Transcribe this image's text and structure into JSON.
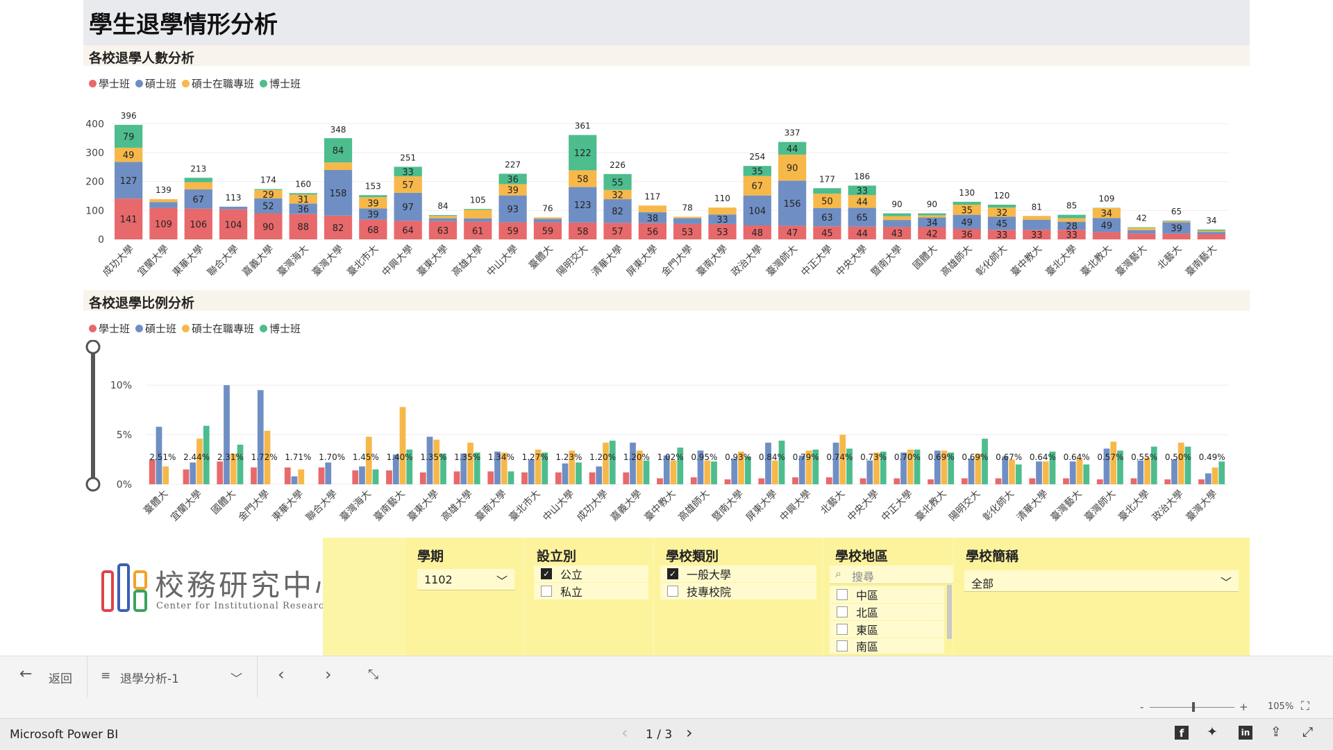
{
  "title": "學生退學情形分析",
  "colors": {
    "bachelor": "#e8696b",
    "master": "#6f8fc4",
    "inservice": "#f7b84a",
    "phd": "#4dbd8e",
    "title_bg": "#e9eaee",
    "section_bg": "#f8f4ec",
    "slicer_bg": "#fdf39d"
  },
  "legend": [
    "學士班",
    "碩士班",
    "碩士在職專班",
    "博士班"
  ],
  "section1": {
    "title": "各校退學人數分析"
  },
  "section2": {
    "title": "各校退學比例分析"
  },
  "chart_data": [
    {
      "type": "bar",
      "stacked": true,
      "title": "各校退學人數分析",
      "y_ticks": [
        "0",
        "100",
        "200",
        "300",
        "400"
      ],
      "ylim": [
        0,
        420
      ],
      "categories": [
        "成功大學",
        "宜蘭大學",
        "東華大學",
        "聯合大學",
        "嘉義大學",
        "臺灣海大",
        "臺灣大學",
        "臺北市大",
        "中興大學",
        "臺東大學",
        "高雄大學",
        "中山大學",
        "臺體大",
        "陽明交大",
        "清華大學",
        "屏東大學",
        "金門大學",
        "臺南大學",
        "政治大學",
        "臺灣師大",
        "中正大學",
        "中央大學",
        "暨南大學",
        "國體大",
        "高雄師大",
        "彰化師大",
        "臺中教大",
        "臺北大學",
        "臺北教大",
        "臺灣藝大",
        "北藝大",
        "臺南藝大"
      ],
      "totals": [
        396,
        139,
        213,
        113,
        174,
        160,
        348,
        153,
        251,
        84,
        105,
        227,
        76,
        361,
        226,
        117,
        78,
        110,
        254,
        337,
        177,
        186,
        90,
        90,
        130,
        120,
        81,
        85,
        109,
        42,
        65,
        34
      ],
      "series": [
        {
          "name": "學士班",
          "values": [
            141,
            109,
            106,
            104,
            90,
            88,
            82,
            68,
            64,
            63,
            61,
            59,
            59,
            58,
            57,
            56,
            53,
            53,
            48,
            47,
            45,
            44,
            43,
            42,
            36,
            33,
            33,
            33,
            25,
            20,
            20,
            18
          ],
          "labels": [
            "141",
            "109",
            "106",
            "104",
            "90",
            "88",
            "82",
            "68",
            "64",
            "63",
            "61",
            "59",
            "59",
            "58",
            "57",
            "56",
            "53",
            "53",
            "48",
            "47",
            "45",
            "44",
            "43",
            "42",
            "36",
            "33",
            "33",
            "33",
            "",
            "",
            "",
            ""
          ]
        },
        {
          "name": "碩士班",
          "values": [
            127,
            20,
            67,
            9,
            52,
            36,
            158,
            39,
            97,
            10,
            11,
            93,
            12,
            123,
            82,
            38,
            20,
            33,
            104,
            156,
            63,
            65,
            24,
            34,
            49,
            45,
            35,
            28,
            49,
            12,
            39,
            8
          ],
          "labels": [
            "127",
            "",
            "67",
            "",
            "52",
            "36",
            "158",
            "39",
            "97",
            "",
            "",
            "93",
            "",
            "123",
            "82",
            "38",
            "",
            "33",
            "104",
            "156",
            "63",
            "65",
            "",
            "34",
            "49",
            "45",
            "",
            "28",
            "49",
            "",
            "39",
            ""
          ]
        },
        {
          "name": "碩士在職專班",
          "values": [
            49,
            10,
            25,
            0,
            29,
            31,
            26,
            39,
            57,
            8,
            30,
            39,
            5,
            58,
            32,
            23,
            5,
            24,
            67,
            90,
            50,
            44,
            13,
            7,
            35,
            32,
            13,
            12,
            34,
            8,
            4,
            4
          ],
          "labels": [
            "49",
            "",
            "",
            "",
            "29",
            "31",
            "",
            "39",
            "57",
            "",
            "",
            "39",
            "",
            "58",
            "32",
            "",
            "",
            "",
            "67",
            "90",
            "50",
            "44",
            "",
            "",
            "35",
            "32",
            "",
            "",
            "34",
            "",
            "",
            ""
          ]
        },
        {
          "name": "博士班",
          "values": [
            79,
            0,
            15,
            0,
            3,
            5,
            84,
            7,
            33,
            3,
            3,
            36,
            0,
            122,
            55,
            0,
            0,
            0,
            35,
            44,
            19,
            33,
            10,
            7,
            10,
            10,
            0,
            12,
            1,
            2,
            2,
            4
          ],
          "labels": [
            "79",
            "",
            "",
            "",
            "",
            "",
            "84",
            "",
            "33",
            "",
            "",
            "36",
            "",
            "122",
            "55",
            "",
            "",
            "",
            "35",
            "44",
            "",
            "33",
            "",
            "",
            "",
            "",
            "",
            "",
            "",
            "",
            "",
            ""
          ]
        }
      ]
    },
    {
      "type": "bar",
      "title": "各校退學比例分析",
      "y_ticks": [
        "0%",
        "5%",
        "10%"
      ],
      "ylim": [
        0,
        10.5
      ],
      "categories": [
        "臺體大",
        "宜蘭大學",
        "國體大",
        "金門大學",
        "東華大學",
        "聯合大學",
        "臺灣海大",
        "臺南藝大",
        "臺東大學",
        "高雄大學",
        "臺南大學",
        "臺北市大",
        "中山大學",
        "成功大學",
        "嘉義大學",
        "臺中教大",
        "高雄師大",
        "暨南大學",
        "屏東大學",
        "中興大學",
        "北藝大",
        "中央大學",
        "中正大學",
        "臺北教大",
        "陽明交大",
        "彰化師大",
        "清華大學",
        "臺灣藝大",
        "臺灣師大",
        "臺北大學",
        "政治大學",
        "臺灣大學"
      ],
      "labels": [
        "2.51%",
        "2.44%",
        "2.31%",
        "1.72%",
        "1.71%",
        "1.70%",
        "1.45%",
        "1.40%",
        "1.35%",
        "1.35%",
        "1.34%",
        "1.27%",
        "1.23%",
        "1.20%",
        "1.20%",
        "1.02%",
        "0.95%",
        "0.93%",
        "0.84%",
        "0.79%",
        "0.74%",
        "0.73%",
        "0.70%",
        "0.69%",
        "0.69%",
        "0.67%",
        "0.64%",
        "0.64%",
        "0.57%",
        "0.55%",
        "0.50%",
        "0.49%"
      ],
      "series": [
        {
          "name": "學士班",
          "values": [
            2.5,
            1.5,
            2.3,
            1.7,
            1.7,
            1.7,
            1.4,
            1.4,
            1.2,
            1.3,
            1.3,
            1.2,
            1.2,
            1.2,
            1.2,
            0.6,
            0.7,
            0.5,
            0.6,
            0.7,
            0.7,
            0.6,
            0.6,
            0.5,
            0.6,
            0.6,
            0.6,
            0.6,
            0.5,
            0.6,
            0.5,
            0.5
          ]
        },
        {
          "name": "碩士班",
          "values": [
            5.8,
            2.2,
            10.0,
            9.5,
            0.8,
            2.2,
            1.8,
            3.0,
            4.8,
            3.1,
            3.3,
            2.5,
            2.1,
            1.8,
            4.2,
            2.9,
            3.4,
            2.6,
            4.2,
            2.9,
            4.2,
            2.4,
            3.2,
            3.4,
            2.6,
            2.8,
            2.3,
            2.3,
            3.6,
            2.4,
            2.5,
            1.1
          ]
        },
        {
          "name": "碩士在職專班",
          "values": [
            1.8,
            4.6,
            3.1,
            5.4,
            1.5,
            0,
            4.8,
            7.8,
            4.5,
            4.2,
            3.2,
            3.5,
            3.4,
            4.2,
            3.4,
            2.4,
            2.4,
            3.3,
            2.4,
            3.4,
            5.0,
            3.2,
            3.5,
            3.4,
            3.1,
            2.5,
            2.3,
            2.6,
            4.3,
            2.7,
            4.2,
            1.7
          ]
        },
        {
          "name": "博士班",
          "values": [
            0,
            5.9,
            4.0,
            0,
            0,
            0,
            1.5,
            3.5,
            3.1,
            3.2,
            1.3,
            3.2,
            2.2,
            4.4,
            2.4,
            3.7,
            2.3,
            2.8,
            4.4,
            3.5,
            3.6,
            3.3,
            3.5,
            3.2,
            4.6,
            2.0,
            3.3,
            2.0,
            3.4,
            3.8,
            3.8,
            2.3
          ]
        }
      ]
    }
  ],
  "logo": {
    "text_zh": "校務研究中心",
    "text_en": "Center for Institutional Research"
  },
  "slicers": {
    "semester": {
      "title": "學期",
      "value": "1102"
    },
    "establishment": {
      "title": "設立別",
      "options": [
        {
          "label": "公立",
          "checked": true
        },
        {
          "label": "私立",
          "checked": false
        }
      ]
    },
    "school_type": {
      "title": "學校類別",
      "options": [
        {
          "label": "一般大學",
          "checked": true
        },
        {
          "label": "技專校院",
          "checked": false
        }
      ]
    },
    "region": {
      "title": "學校地區",
      "search_placeholder": "搜尋",
      "options": [
        {
          "label": "中區",
          "checked": false
        },
        {
          "label": "北區",
          "checked": false
        },
        {
          "label": "東區",
          "checked": false
        },
        {
          "label": "南區",
          "checked": false
        }
      ]
    },
    "school_name": {
      "title": "學校簡稱",
      "value": "全部"
    }
  },
  "nav": {
    "back_label": "返回",
    "page_name": "退學分析-1"
  },
  "zoom": {
    "level": "105%",
    "minus": "-",
    "plus": "+"
  },
  "status": {
    "app_name": "Microsoft Power BI",
    "page_indicator": "1 / 3"
  }
}
